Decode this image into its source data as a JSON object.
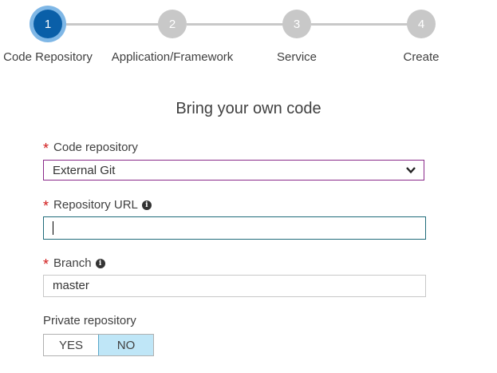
{
  "wizard": {
    "steps": [
      {
        "number": "1",
        "label": "Code Repository",
        "active": true
      },
      {
        "number": "2",
        "label": "Application/Framework",
        "active": false
      },
      {
        "number": "3",
        "label": "Service",
        "active": false
      },
      {
        "number": "4",
        "label": "Create",
        "active": false
      }
    ]
  },
  "form": {
    "title": "Bring your own code",
    "required_marker": "*",
    "code_repository": {
      "label": "Code repository",
      "value": "External Git"
    },
    "repository_url": {
      "label": "Repository URL",
      "value": ""
    },
    "branch": {
      "label": "Branch",
      "value": "master"
    },
    "private_repository": {
      "label": "Private repository",
      "yes_label": "YES",
      "no_label": "NO",
      "selected": "NO"
    }
  },
  "colors": {
    "active_step": "#0a5fa8",
    "inactive_step": "#c8c8c8",
    "required": "#d11a1a",
    "toggle_selected": "#bfe6f7"
  },
  "icons": {
    "info": "info-circle-icon",
    "dropdown": "chevron-down-icon"
  }
}
